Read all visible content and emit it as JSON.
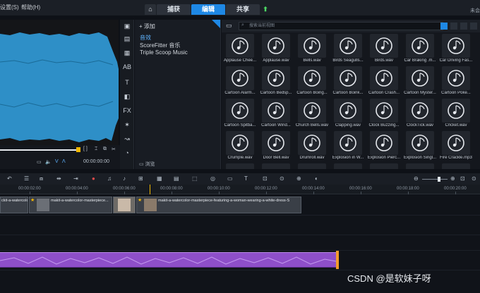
{
  "menubar": {
    "items": [
      "设置(S)",
      "帮助(H)"
    ],
    "tabs": [
      "捕获",
      "编辑",
      "共享"
    ],
    "active_tab": "编辑",
    "corner_text": "未会"
  },
  "library": {
    "add_label": "添加",
    "items": [
      "音效",
      "ScoreFitter 音乐",
      "Triple Scoop Music"
    ],
    "selected": "音效",
    "browse_label": "浏览"
  },
  "search": {
    "placeholder": "搜索当前视图"
  },
  "grid": {
    "tiles": [
      "Applause Chee...",
      "Applause.wav",
      "Bells.wav",
      "Birds Seagulls...",
      "Birds.wav",
      "Car Braking .m...",
      "Car Driving Fas...",
      "Cartoon Alarm...",
      "Cartoon Bedsp...",
      "Cartoon Boing...",
      "Cartoon Boink...",
      "Cartoon Crash...",
      "Cartoon Myster...",
      "Cartoon Poke...",
      "Cartoon Spitba...",
      "Cartoon Wind...",
      "Church Bells.wav",
      "Clapping.wav",
      "Clock Buzzing...",
      "ClockTick.wav",
      "Cricket.wav",
      "Crumple.wav",
      "Door Bell.wav",
      "Drumroll.wav",
      "Explosion in W...",
      "Explosion Pierc...",
      "Explosion Singl...",
      "Fire Crackle.mp3"
    ]
  },
  "transport": {
    "timecode": "00:00:00:00"
  },
  "ruler": {
    "labels": [
      "00:00:02:00",
      "00:00:04:00",
      "00:00:06:00",
      "00:00:08:00",
      "00:00:10:00",
      "00:00:12:00",
      "00:00:14:00",
      "00:00:16:00",
      "00:00:18:00",
      "00:00:20:00"
    ]
  },
  "timeline": {
    "clip1_label": "ckit-a-watercolor",
    "clip2_label": "makit-a-watercolor-masterpiece...",
    "clip3_label": "makit-a-watercolor-masterpiece-featuring-a-woman-wearing-a-white-dress-S"
  },
  "watermark": "CSDN @是软妹子呀",
  "colors": {
    "accent": "#1e88e5",
    "audio_clip": "#8e4fc9",
    "audio_end": "#f39a2b",
    "star": "#f5b800"
  }
}
